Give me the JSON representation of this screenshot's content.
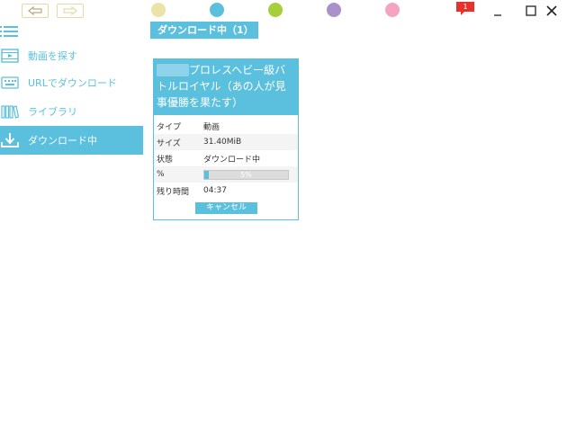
{
  "titlebar": {
    "back_icon": "back-arrow-icon",
    "forward_icon": "forward-arrow-icon",
    "color_dots": [
      "#ebe3a7",
      "#5bc0de",
      "#a6cf3b",
      "#a991cc",
      "#f4a4c2"
    ],
    "notification_count": "1",
    "accent_red": "#e5322d"
  },
  "sidebar": {
    "menu_icon": "hamburger-menu-icon",
    "items": [
      {
        "label": "動画を探す",
        "icon": "film-icon"
      },
      {
        "label": "URLでダウンロード",
        "icon": "keyboard-icon"
      },
      {
        "label": "ライブラリ",
        "icon": "library-books-icon"
      },
      {
        "label": "ダウンロード中",
        "icon": "download-icon",
        "active": true
      }
    ]
  },
  "main": {
    "section_title": "ダウンロード中（1）",
    "download": {
      "title": "プロレスヘビー級バトルロイヤル（あの人が見事優勝を果たす）",
      "rows": [
        {
          "key": "タイプ",
          "value": "動画"
        },
        {
          "key": "サイズ",
          "value": "31.40MiB"
        },
        {
          "key": "状態",
          "value": "ダウンロード中"
        },
        {
          "key": "%",
          "progress": 0.05,
          "progress_text": "5%"
        },
        {
          "key": "残り時間",
          "value": "04:37"
        }
      ],
      "cancel_label": "キャンセル"
    }
  },
  "colors": {
    "accent": "#5bc0de"
  }
}
